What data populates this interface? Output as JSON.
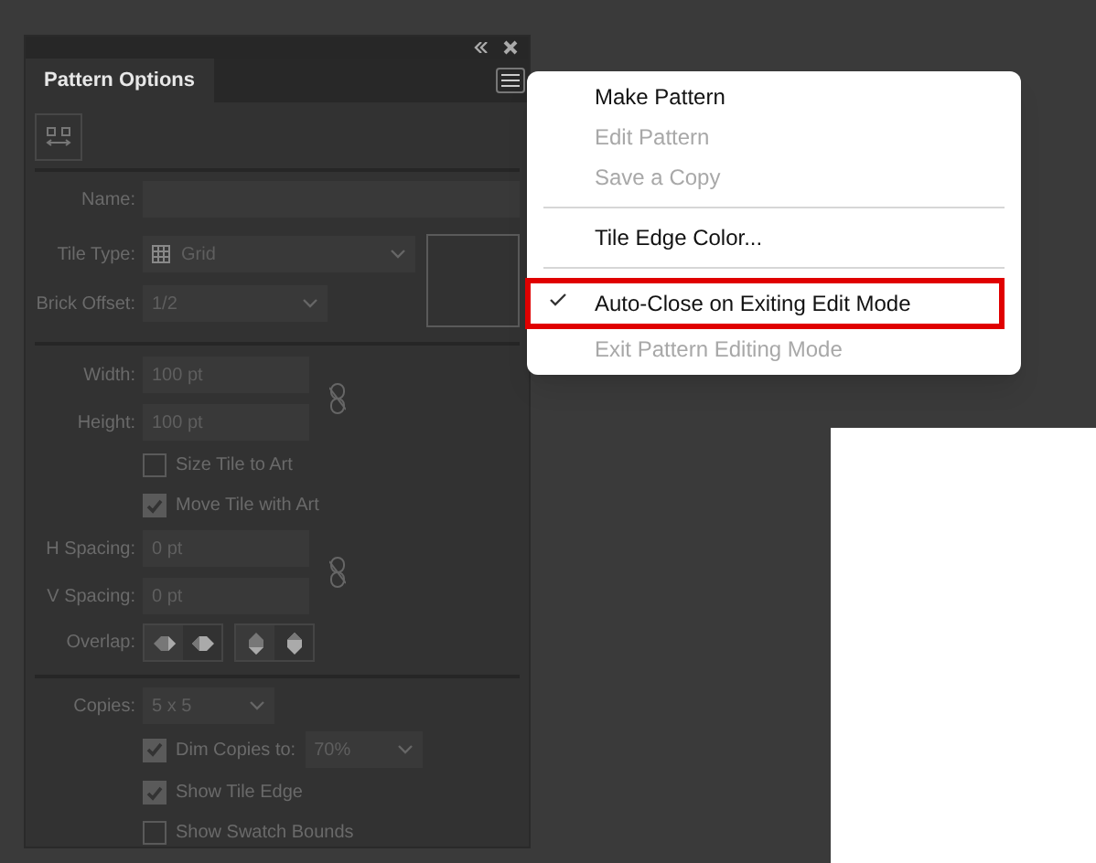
{
  "panel": {
    "tab": {
      "label": "Pattern Options",
      "selected": true
    },
    "disabled": true,
    "name": {
      "label": "Name:"
    },
    "tile_type": {
      "label": "Tile Type:",
      "value": "Grid"
    },
    "brick_offset": {
      "label": "Brick Offset:",
      "value": "1/2"
    },
    "width": {
      "label": "Width:",
      "value": "100 pt"
    },
    "height": {
      "label": "Height:",
      "value": "100 pt"
    },
    "size_tile_to_art": {
      "label": "Size Tile to Art",
      "checked": false
    },
    "move_tile_with_art": {
      "label": "Move Tile with Art",
      "checked": true
    },
    "h_spacing": {
      "label": "H Spacing:",
      "value": "0 pt"
    },
    "v_spacing": {
      "label": "V Spacing:",
      "value": "0 pt"
    },
    "overlap": {
      "label": "Overlap:"
    },
    "copies": {
      "label": "Copies:",
      "value": "5 x 5"
    },
    "dim_copies": {
      "label": "Dim Copies to:",
      "checked": true,
      "value": "70%"
    },
    "show_tile_edge": {
      "label": "Show Tile Edge",
      "checked": true
    },
    "show_swatch_bounds": {
      "label": "Show Swatch Bounds",
      "checked": false
    }
  },
  "menu": {
    "items": [
      {
        "kind": "item",
        "label": "Make Pattern",
        "disabled": false,
        "checked": false,
        "outlined": false
      },
      {
        "kind": "item",
        "label": "Edit Pattern",
        "disabled": true,
        "checked": false,
        "outlined": false
      },
      {
        "kind": "item",
        "label": "Save a Copy",
        "disabled": true,
        "checked": false,
        "outlined": false
      },
      {
        "kind": "separator"
      },
      {
        "kind": "item",
        "label": "Tile Edge Color...",
        "disabled": false,
        "checked": false,
        "outlined": false
      },
      {
        "kind": "separator"
      },
      {
        "kind": "item",
        "label": "Auto-Close on Exiting Edit Mode",
        "disabled": false,
        "checked": true,
        "outlined": true
      },
      {
        "kind": "item",
        "label": "Exit Pattern Editing Mode",
        "disabled": true,
        "checked": false,
        "outlined": false
      }
    ]
  }
}
